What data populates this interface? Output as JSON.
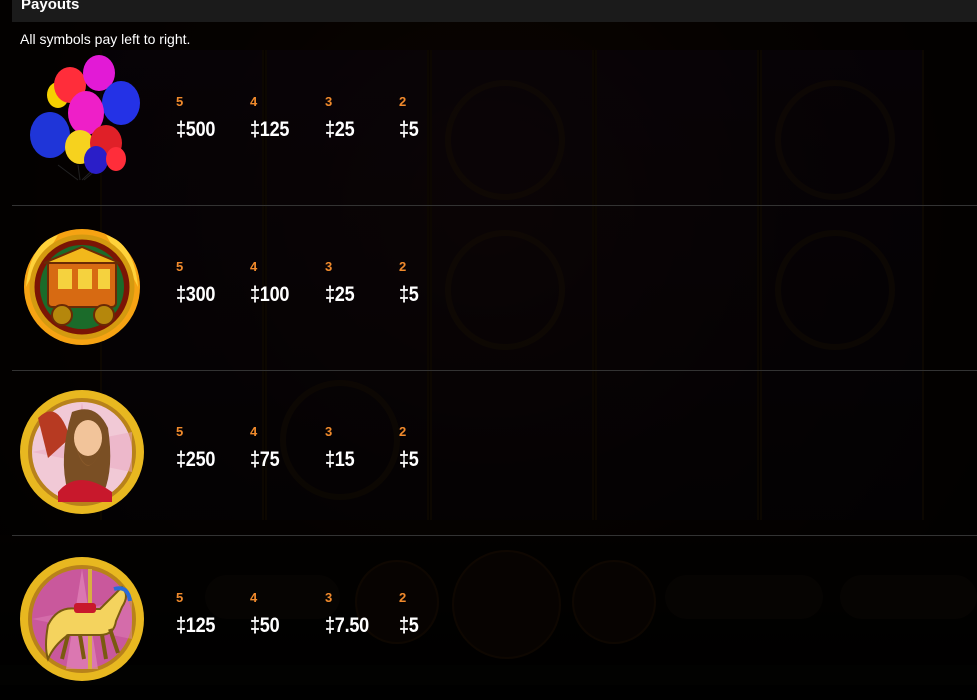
{
  "panel": {
    "title": "Payouts",
    "intro": "All symbols pay left to right."
  },
  "payouts": [
    {
      "symbol": "balloons-symbol",
      "entries": [
        {
          "count": "5",
          "amount": "‡500"
        },
        {
          "count": "4",
          "amount": "‡125"
        },
        {
          "count": "3",
          "amount": "‡25"
        },
        {
          "count": "2",
          "amount": "‡5"
        }
      ]
    },
    {
      "symbol": "wagon-symbol",
      "entries": [
        {
          "count": "5",
          "amount": "‡300"
        },
        {
          "count": "4",
          "amount": "‡100"
        },
        {
          "count": "3",
          "amount": "‡25"
        },
        {
          "count": "2",
          "amount": "‡5"
        }
      ]
    },
    {
      "symbol": "bearded-lady-symbol",
      "entries": [
        {
          "count": "5",
          "amount": "‡250"
        },
        {
          "count": "4",
          "amount": "‡75"
        },
        {
          "count": "3",
          "amount": "‡15"
        },
        {
          "count": "2",
          "amount": "‡5"
        }
      ]
    },
    {
      "symbol": "carousel-horse-symbol",
      "entries": [
        {
          "count": "5",
          "amount": "‡125"
        },
        {
          "count": "4",
          "amount": "‡50"
        },
        {
          "count": "3",
          "amount": "‡7.50"
        },
        {
          "count": "2",
          "amount": "‡5"
        }
      ]
    }
  ],
  "colors": {
    "count": "#f08a2c",
    "panel_header": "#1b1b1b"
  }
}
